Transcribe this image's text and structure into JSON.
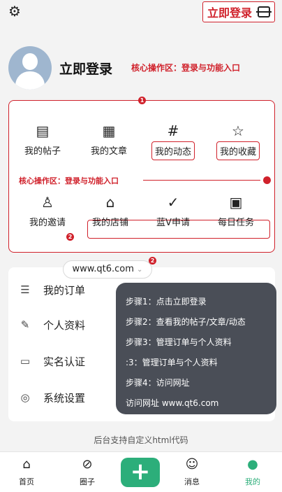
{
  "header": {
    "settings_icon": "gear-icon",
    "login_label": "立即登录",
    "scan_icon": "scan-icon"
  },
  "profile": {
    "name": "立即登录",
    "annotation": "核心操作区：登录与功能入口"
  },
  "grid": {
    "row1": [
      {
        "label": "我的帖子",
        "icon": "posts-icon"
      },
      {
        "label": "我的文章",
        "icon": "article-icon"
      },
      {
        "label": "我的动态",
        "icon": "hashtag-icon"
      },
      {
        "label": "我的收藏",
        "icon": "star-icon"
      }
    ],
    "annotation": "核心操作区：登录与功能入口",
    "row2": [
      {
        "label": "我的邀请",
        "icon": "invite-icon"
      },
      {
        "label": "我的店铺",
        "icon": "store-icon"
      },
      {
        "label": "蓝V申请",
        "icon": "verified-icon"
      },
      {
        "label": "每日任务",
        "icon": "calendar-icon"
      }
    ],
    "badges": [
      "1",
      "2",
      "2"
    ]
  },
  "url_pill": "www.qt6.com",
  "menu": [
    {
      "label": "我的订单",
      "icon": "order-icon"
    },
    {
      "label": "个人资料",
      "icon": "edit-icon"
    },
    {
      "label": "实名认证",
      "icon": "id-card-icon"
    },
    {
      "label": "系统设置",
      "icon": "settings-icon"
    }
  ],
  "steps": [
    "步骤1：点击立即登录",
    "步骤2：查看我的帖子/文章/动态",
    "步骤3：管理订单与个人资料",
    ":3：管理订单与个人资料",
    "步骤4：访问网址",
    "访问网址  www.qt6.com"
  ],
  "footer_note": "后台支持自定义html代码",
  "tabs": [
    {
      "label": "首页",
      "icon": "home-icon"
    },
    {
      "label": "圈子",
      "icon": "compass-icon"
    },
    {
      "label": "消息",
      "icon": "message-icon"
    },
    {
      "label": "我的",
      "icon": "profile-icon",
      "active": true
    }
  ],
  "colors": {
    "accent": "#d0212b",
    "brand_green": "#2cae7a",
    "tooltip_bg": "#4a4e57"
  }
}
